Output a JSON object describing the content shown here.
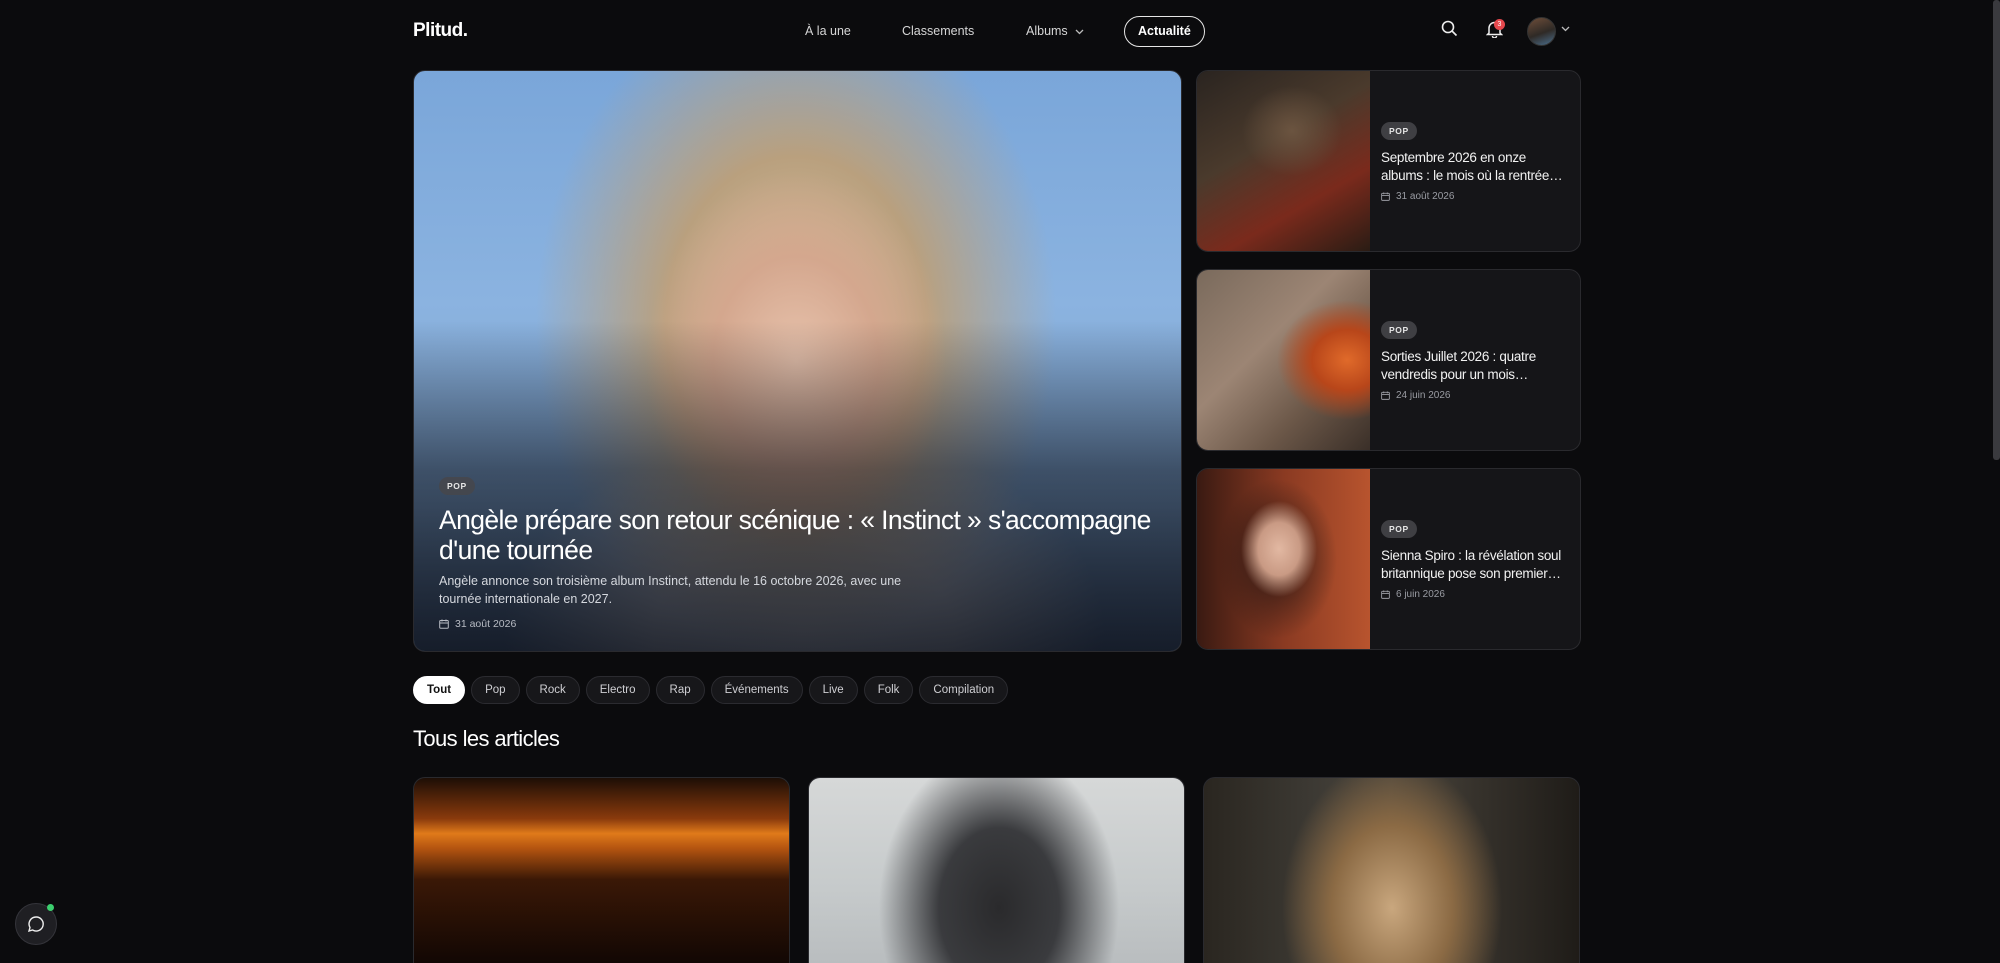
{
  "header": {
    "logo": "Plitud.",
    "nav": [
      {
        "label": "À la une"
      },
      {
        "label": "Classements"
      },
      {
        "label": "Albums"
      },
      {
        "label": "Actualité"
      }
    ],
    "notification_count": "3"
  },
  "hero": {
    "tag": "POP",
    "title": "Angèle prépare son retour scénique : « Instinct » s'accompagne d'une tournée",
    "description": "Angèle annonce son troisième album Instinct, attendu le 16 octobre 2026, avec une tournée internationale en 2027.",
    "date": "31 août 2026"
  },
  "side_articles": [
    {
      "tag": "POP",
      "title": "Septembre 2026 en onze albums : le mois où la rentrée…",
      "date": "31 août 2026"
    },
    {
      "tag": "POP",
      "title": "Sorties Juillet 2026 : quatre vendredis pour un mois…",
      "date": "24 juin 2026"
    },
    {
      "tag": "POP",
      "title": "Sienna Spiro : la révélation soul britannique pose son premier…",
      "date": "6 juin 2026"
    }
  ],
  "filters": [
    "Tout",
    "Pop",
    "Rock",
    "Electro",
    "Rap",
    "Événements",
    "Live",
    "Folk",
    "Compilation"
  ],
  "active_filter": "Tout",
  "section_title": "Tous les articles",
  "colors": {
    "background": "#0b0b0d",
    "card": "#151518",
    "accent_notification": "#e5484d",
    "online": "#3ccf6e"
  }
}
